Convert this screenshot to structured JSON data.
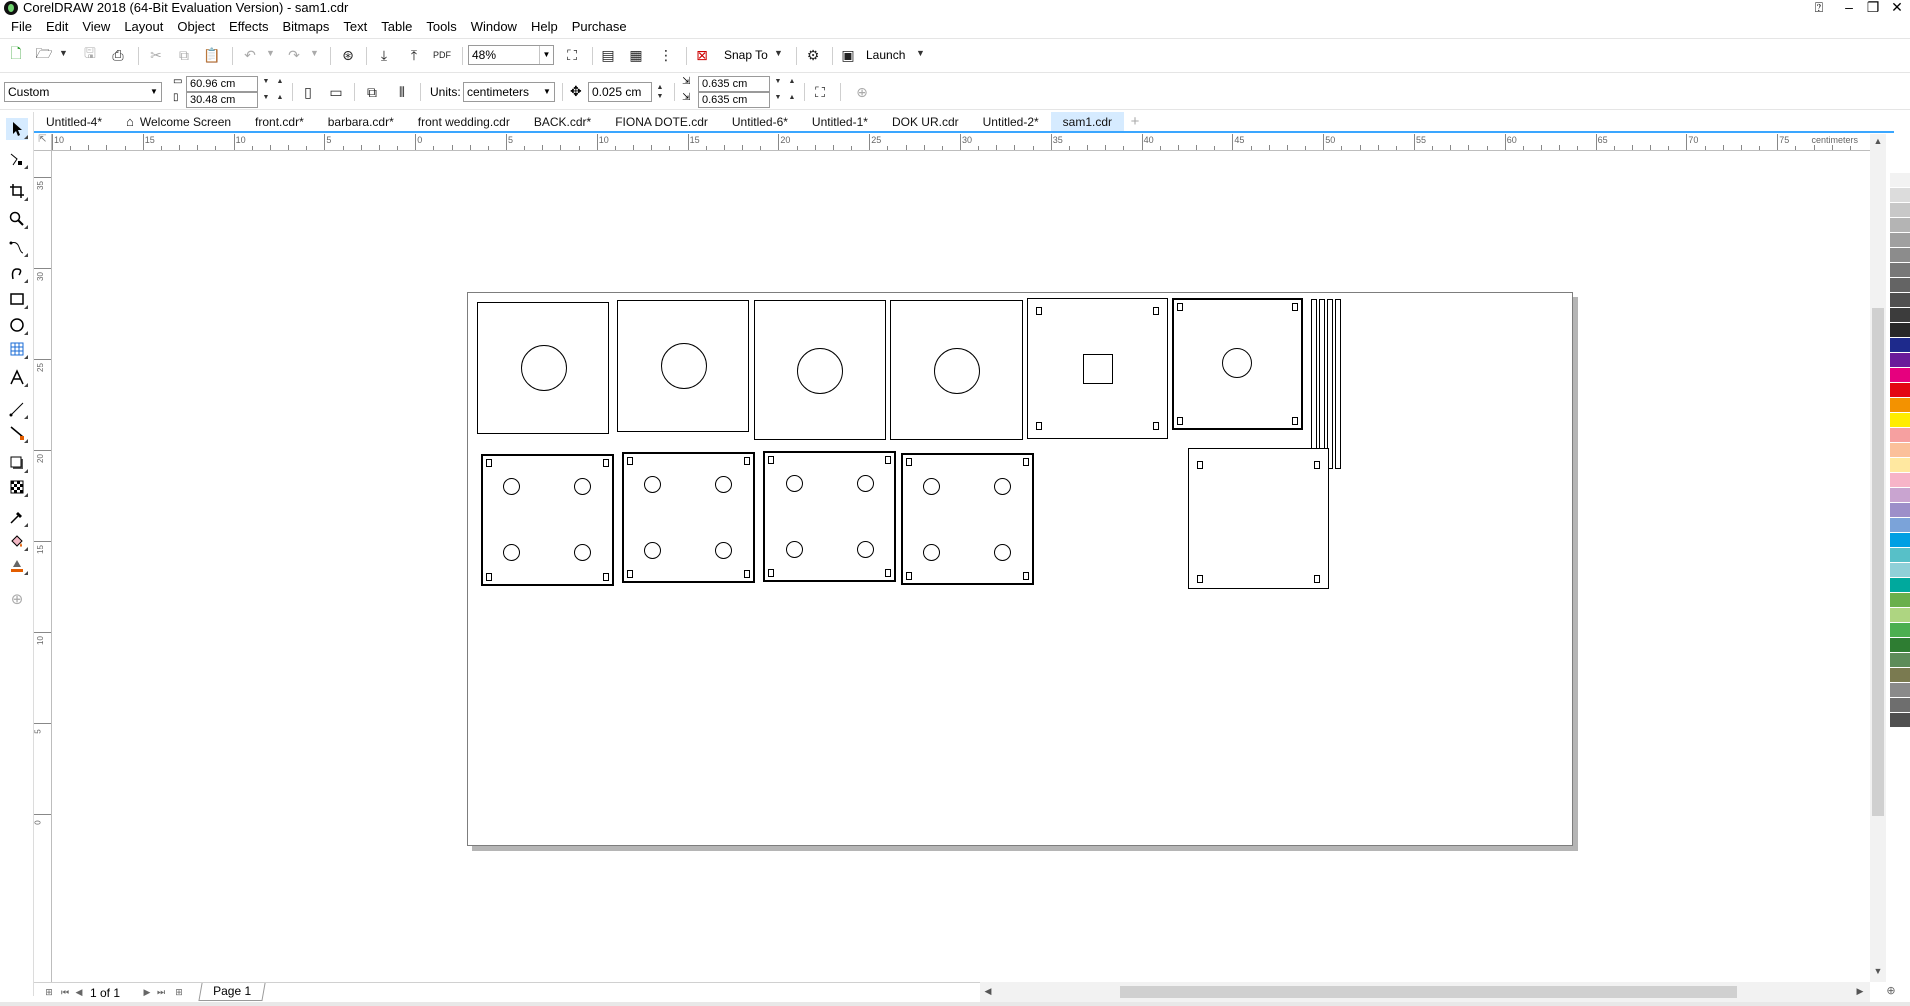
{
  "window": {
    "title": "CorelDRAW 2018 (64-Bit Evaluation Version) - sam1.cdr"
  },
  "menu": [
    "File",
    "Edit",
    "View",
    "Layout",
    "Object",
    "Effects",
    "Bitmaps",
    "Text",
    "Table",
    "Tools",
    "Window",
    "Help",
    "Purchase"
  ],
  "toolbar": {
    "zoom": "48%",
    "snap_label": "Snap To",
    "launch_label": "Launch",
    "pdf_label": "PDF"
  },
  "propbar": {
    "page_preset": "Custom",
    "page_width": "60.96 cm",
    "page_height": "30.48 cm",
    "units_label": "Units:",
    "units_value": "centimeters",
    "nudge": "0.025 cm",
    "dup_x": "0.635 cm",
    "dup_y": "0.635 cm"
  },
  "tabs": [
    {
      "label": "Untitled-4*",
      "active": false
    },
    {
      "label": "Welcome Screen",
      "active": false,
      "home": true
    },
    {
      "label": "front.cdr*",
      "active": false
    },
    {
      "label": "barbara.cdr*",
      "active": false
    },
    {
      "label": "front wedding.cdr",
      "active": false
    },
    {
      "label": "BACK.cdr*",
      "active": false
    },
    {
      "label": "FIONA DOTE.cdr",
      "active": false
    },
    {
      "label": "Untitled-6*",
      "active": false
    },
    {
      "label": "Untitled-1*",
      "active": false
    },
    {
      "label": "DOK UR.cdr",
      "active": false
    },
    {
      "label": "Untitled-2*",
      "active": false
    },
    {
      "label": "sam1.cdr",
      "active": true
    }
  ],
  "ruler": {
    "h_labels": [
      "10",
      "15",
      "10",
      "5",
      "0",
      "5",
      "10",
      "15",
      "20",
      "25",
      "30",
      "35",
      "40",
      "45",
      "50",
      "55",
      "60",
      "65",
      "70",
      "75"
    ],
    "units": "centimeters",
    "v_labels": [
      "35",
      "30",
      "25",
      "20",
      "15",
      "10",
      "5",
      "0"
    ]
  },
  "pagenav": {
    "page_count": "1 of 1",
    "page_tab": "Page 1"
  },
  "palette": [
    "#ffffff",
    "#f2f2f2",
    "#dcdcdc",
    "#c8c8c8",
    "#b4b4b4",
    "#a0a0a0",
    "#8c8c8c",
    "#787878",
    "#646464",
    "#505050",
    "#3c3c3c",
    "#282828",
    "#1e2a8c",
    "#6a1b9a",
    "#e6007e",
    "#e30613",
    "#f39200",
    "#ffed00",
    "#f6a0a0",
    "#fbc09a",
    "#ffe8a0",
    "#f7b4c8",
    "#c9a4d0",
    "#9d8fc9",
    "#7ba3d9",
    "#009fe3",
    "#57c0c8",
    "#8fd0d8",
    "#00a99d",
    "#6ab04c",
    "#aed581",
    "#4caf50",
    "#2e7d32",
    "#5d8c5a",
    "#7a7a50",
    "#8a8a8a",
    "#6e6e6e",
    "#505050"
  ]
}
